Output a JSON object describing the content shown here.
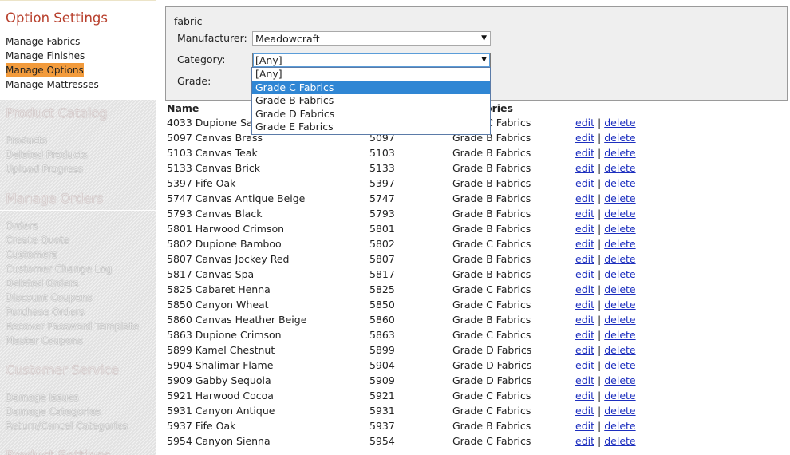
{
  "sidebar": {
    "option_settings": {
      "title": "Option Settings",
      "links": [
        "Manage Fabrics",
        "Manage Finishes",
        "Manage Options",
        "Manage Mattresses"
      ]
    },
    "product_catalog": {
      "title": "Product Catalog",
      "links": [
        "Products",
        "Deleted Products",
        "Upload Progress"
      ]
    },
    "manage_orders": {
      "title": "Manage Orders",
      "links": [
        "Orders",
        "Create Quote",
        "Customers",
        "Customer Change Log",
        "Deleted Orders",
        "Discount Coupons",
        "Purchase Orders",
        "Recover Password Template",
        "Master Coupons"
      ]
    },
    "customer_service": {
      "title": "Customer Service",
      "links": [
        "Damage Issues",
        "Damage Categories",
        "Return/Cancel Categories"
      ]
    },
    "product_settings": {
      "title": "Product Settings"
    }
  },
  "filter": {
    "heading": "fabric",
    "manufacturer_label": "Manufacturer:",
    "manufacturer_value": "Meadowcraft",
    "category_label": "Category:",
    "category_value": "[Any]",
    "grade_label": "Grade:"
  },
  "dropdown": {
    "options": [
      "[Any]",
      "Grade C Fabrics",
      "Grade B Fabrics",
      "Grade D Fabrics",
      "Grade E Fabrics"
    ],
    "highlighted_index": 1
  },
  "table": {
    "headers": {
      "name": "Name",
      "code": "",
      "category": "Categories"
    },
    "edit_label": "edit",
    "delete_label": "delete",
    "separator": "|",
    "rows": [
      {
        "name": "4033 Dupione Sand",
        "code": "",
        "category": "Grade C Fabrics"
      },
      {
        "name": "5097 Canvas Brass",
        "code": "5097",
        "category": "Grade B Fabrics"
      },
      {
        "name": "5103 Canvas Teak",
        "code": "5103",
        "category": "Grade B Fabrics"
      },
      {
        "name": "5133 Canvas Brick",
        "code": "5133",
        "category": "Grade B Fabrics"
      },
      {
        "name": "5397 Fife Oak",
        "code": "5397",
        "category": "Grade B Fabrics"
      },
      {
        "name": "5747 Canvas Antique Beige",
        "code": "5747",
        "category": "Grade B Fabrics"
      },
      {
        "name": "5793 Canvas Black",
        "code": "5793",
        "category": "Grade B Fabrics"
      },
      {
        "name": "5801 Harwood Crimson",
        "code": "5801",
        "category": "Grade B Fabrics"
      },
      {
        "name": "5802 Dupione Bamboo",
        "code": "5802",
        "category": "Grade C Fabrics"
      },
      {
        "name": "5807 Canvas Jockey Red",
        "code": "5807",
        "category": "Grade B Fabrics"
      },
      {
        "name": "5817 Canvas Spa",
        "code": "5817",
        "category": "Grade B Fabrics"
      },
      {
        "name": "5825 Cabaret Henna",
        "code": "5825",
        "category": "Grade C Fabrics"
      },
      {
        "name": "5850 Canyon Wheat",
        "code": "5850",
        "category": "Grade C Fabrics"
      },
      {
        "name": "5860 Canvas Heather Beige",
        "code": "5860",
        "category": "Grade B Fabrics"
      },
      {
        "name": "5863 Dupione Crimson",
        "code": "5863",
        "category": "Grade C Fabrics"
      },
      {
        "name": "5899 Kamel Chestnut",
        "code": "5899",
        "category": "Grade D Fabrics"
      },
      {
        "name": "5904 Shalimar Flame",
        "code": "5904",
        "category": "Grade D Fabrics"
      },
      {
        "name": "5909 Gabby Sequoia",
        "code": "5909",
        "category": "Grade D Fabrics"
      },
      {
        "name": "5921 Harwood Cocoa",
        "code": "5921",
        "category": "Grade C Fabrics"
      },
      {
        "name": "5931 Canyon Antique",
        "code": "5931",
        "category": "Grade C Fabrics"
      },
      {
        "name": "5937 Fife Oak",
        "code": "5937",
        "category": "Grade B Fabrics"
      },
      {
        "name": "5954 Canyon Sienna",
        "code": "5954",
        "category": "Grade C Fabrics"
      }
    ]
  },
  "colors": {
    "accent_title": "#b8402d",
    "selected_link_bg": "#f29b3c",
    "dropdown_highlight": "#2f86d4",
    "link": "#1d2fbf"
  }
}
